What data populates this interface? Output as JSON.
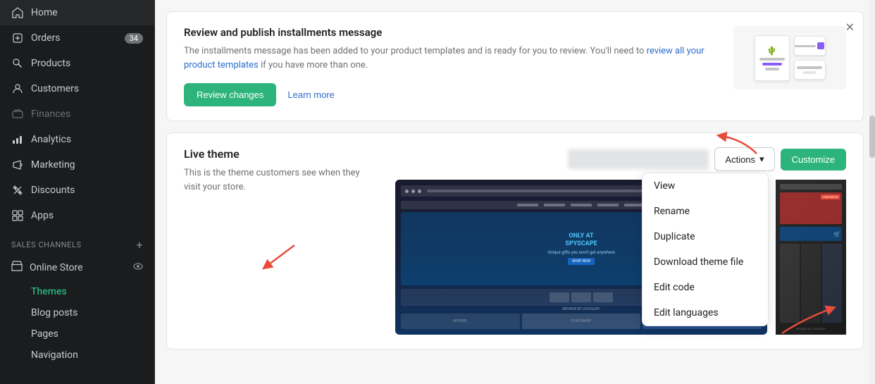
{
  "sidebar": {
    "nav_items": [
      {
        "id": "home",
        "label": "Home",
        "icon": "🏠",
        "badge": null,
        "disabled": false
      },
      {
        "id": "orders",
        "label": "Orders",
        "icon": "↓",
        "badge": "34",
        "disabled": false
      },
      {
        "id": "products",
        "label": "Products",
        "icon": "🏷️",
        "badge": null,
        "disabled": false
      },
      {
        "id": "customers",
        "label": "Customers",
        "icon": "👤",
        "badge": null,
        "disabled": false
      },
      {
        "id": "finances",
        "label": "Finances",
        "icon": "💳",
        "badge": null,
        "disabled": true
      },
      {
        "id": "analytics",
        "label": "Analytics",
        "icon": "📊",
        "badge": null,
        "disabled": false
      },
      {
        "id": "marketing",
        "label": "Marketing",
        "icon": "📢",
        "badge": null,
        "disabled": false
      },
      {
        "id": "discounts",
        "label": "Discounts",
        "icon": "🏷",
        "badge": null,
        "disabled": false
      },
      {
        "id": "apps",
        "label": "Apps",
        "icon": "⊞",
        "badge": null,
        "disabled": false
      }
    ],
    "sales_channels_label": "SALES CHANNELS",
    "online_store_label": "Online Store",
    "sub_items": [
      {
        "id": "themes",
        "label": "Themes",
        "active": true
      },
      {
        "id": "blog-posts",
        "label": "Blog posts",
        "active": false
      },
      {
        "id": "pages",
        "label": "Pages",
        "active": false
      },
      {
        "id": "navigation",
        "label": "Navigation",
        "active": false
      }
    ]
  },
  "notification": {
    "title": "Review and publish installments message",
    "description": "The installments message has been added to your product templates and is ready for you to review. You'll need to review all your product templates if you have more than one.",
    "review_btn": "Review changes",
    "learn_btn": "Learn more"
  },
  "live_theme": {
    "title": "Live theme",
    "description": "This is the theme customers see when they visit your store.",
    "theme_name_placeholder": "████████████████████",
    "actions_label": "Actions",
    "customize_label": "Customize",
    "dropdown_items": [
      {
        "id": "view",
        "label": "View"
      },
      {
        "id": "rename",
        "label": "Rename"
      },
      {
        "id": "duplicate",
        "label": "Duplicate"
      },
      {
        "id": "download",
        "label": "Download theme file"
      },
      {
        "id": "edit-code",
        "label": "Edit code"
      },
      {
        "id": "edit-languages",
        "label": "Edit languages"
      }
    ]
  }
}
